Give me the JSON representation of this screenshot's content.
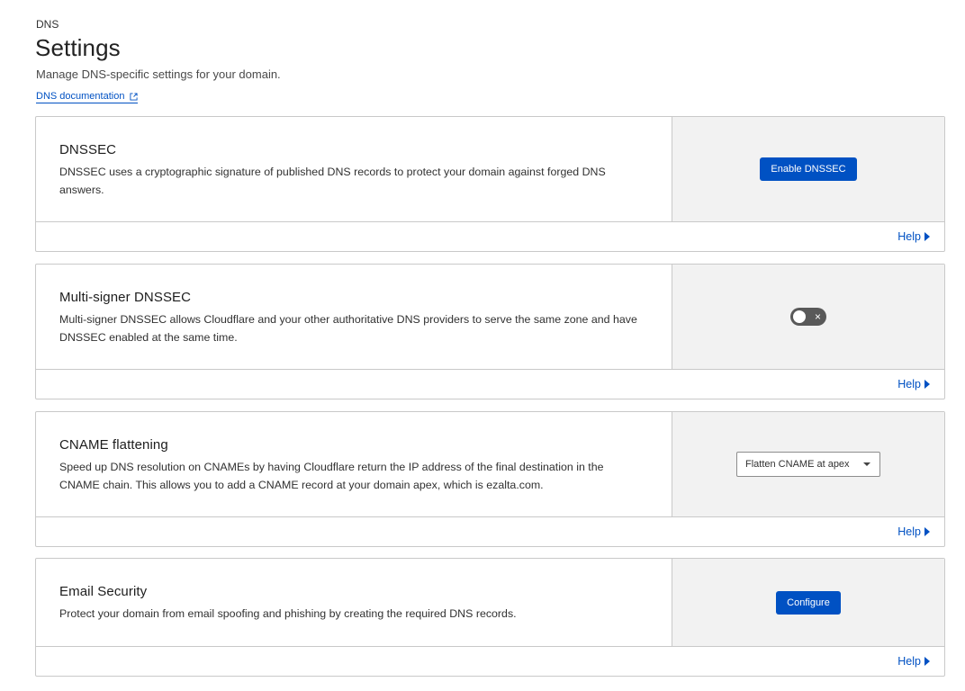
{
  "header": {
    "breadcrumb": "DNS",
    "title": "Settings",
    "subtitle": "Manage DNS-specific settings for your domain.",
    "doc_link": "DNS documentation"
  },
  "cards": [
    {
      "title": "DNSSEC",
      "description": "DNSSEC uses a cryptographic signature of published DNS records to protect your domain against forged DNS answers.",
      "action_label": "Enable DNSSEC",
      "help": "Help"
    },
    {
      "title": "Multi-signer DNSSEC",
      "description": "Multi-signer DNSSEC allows Cloudflare and your other authoritative DNS providers to serve the same zone and have DNSSEC enabled at the same time.",
      "toggle_on": false,
      "toggle_off_icon": "×",
      "help": "Help"
    },
    {
      "title": "CNAME flattening",
      "description": "Speed up DNS resolution on CNAMEs by having Cloudflare return the IP address of the final destination in the CNAME chain. This allows you to add a CNAME record at your domain apex, which is ezalta.com.",
      "select_value": "Flatten CNAME at apex",
      "help": "Help"
    },
    {
      "title": "Email Security",
      "description": "Protect your domain from email spoofing and phishing by creating the required DNS records.",
      "action_label": "Configure",
      "help": "Help"
    }
  ],
  "colors": {
    "link": "#0051c3",
    "primary_button": "#0051c3",
    "panel_bg": "#f2f2f2",
    "border": "#c9c9c9",
    "toggle_off": "#595959"
  },
  "icons": {
    "doc_link": "external-link-icon",
    "help": "caret-right-icon",
    "select": "chevron-down-icon"
  }
}
